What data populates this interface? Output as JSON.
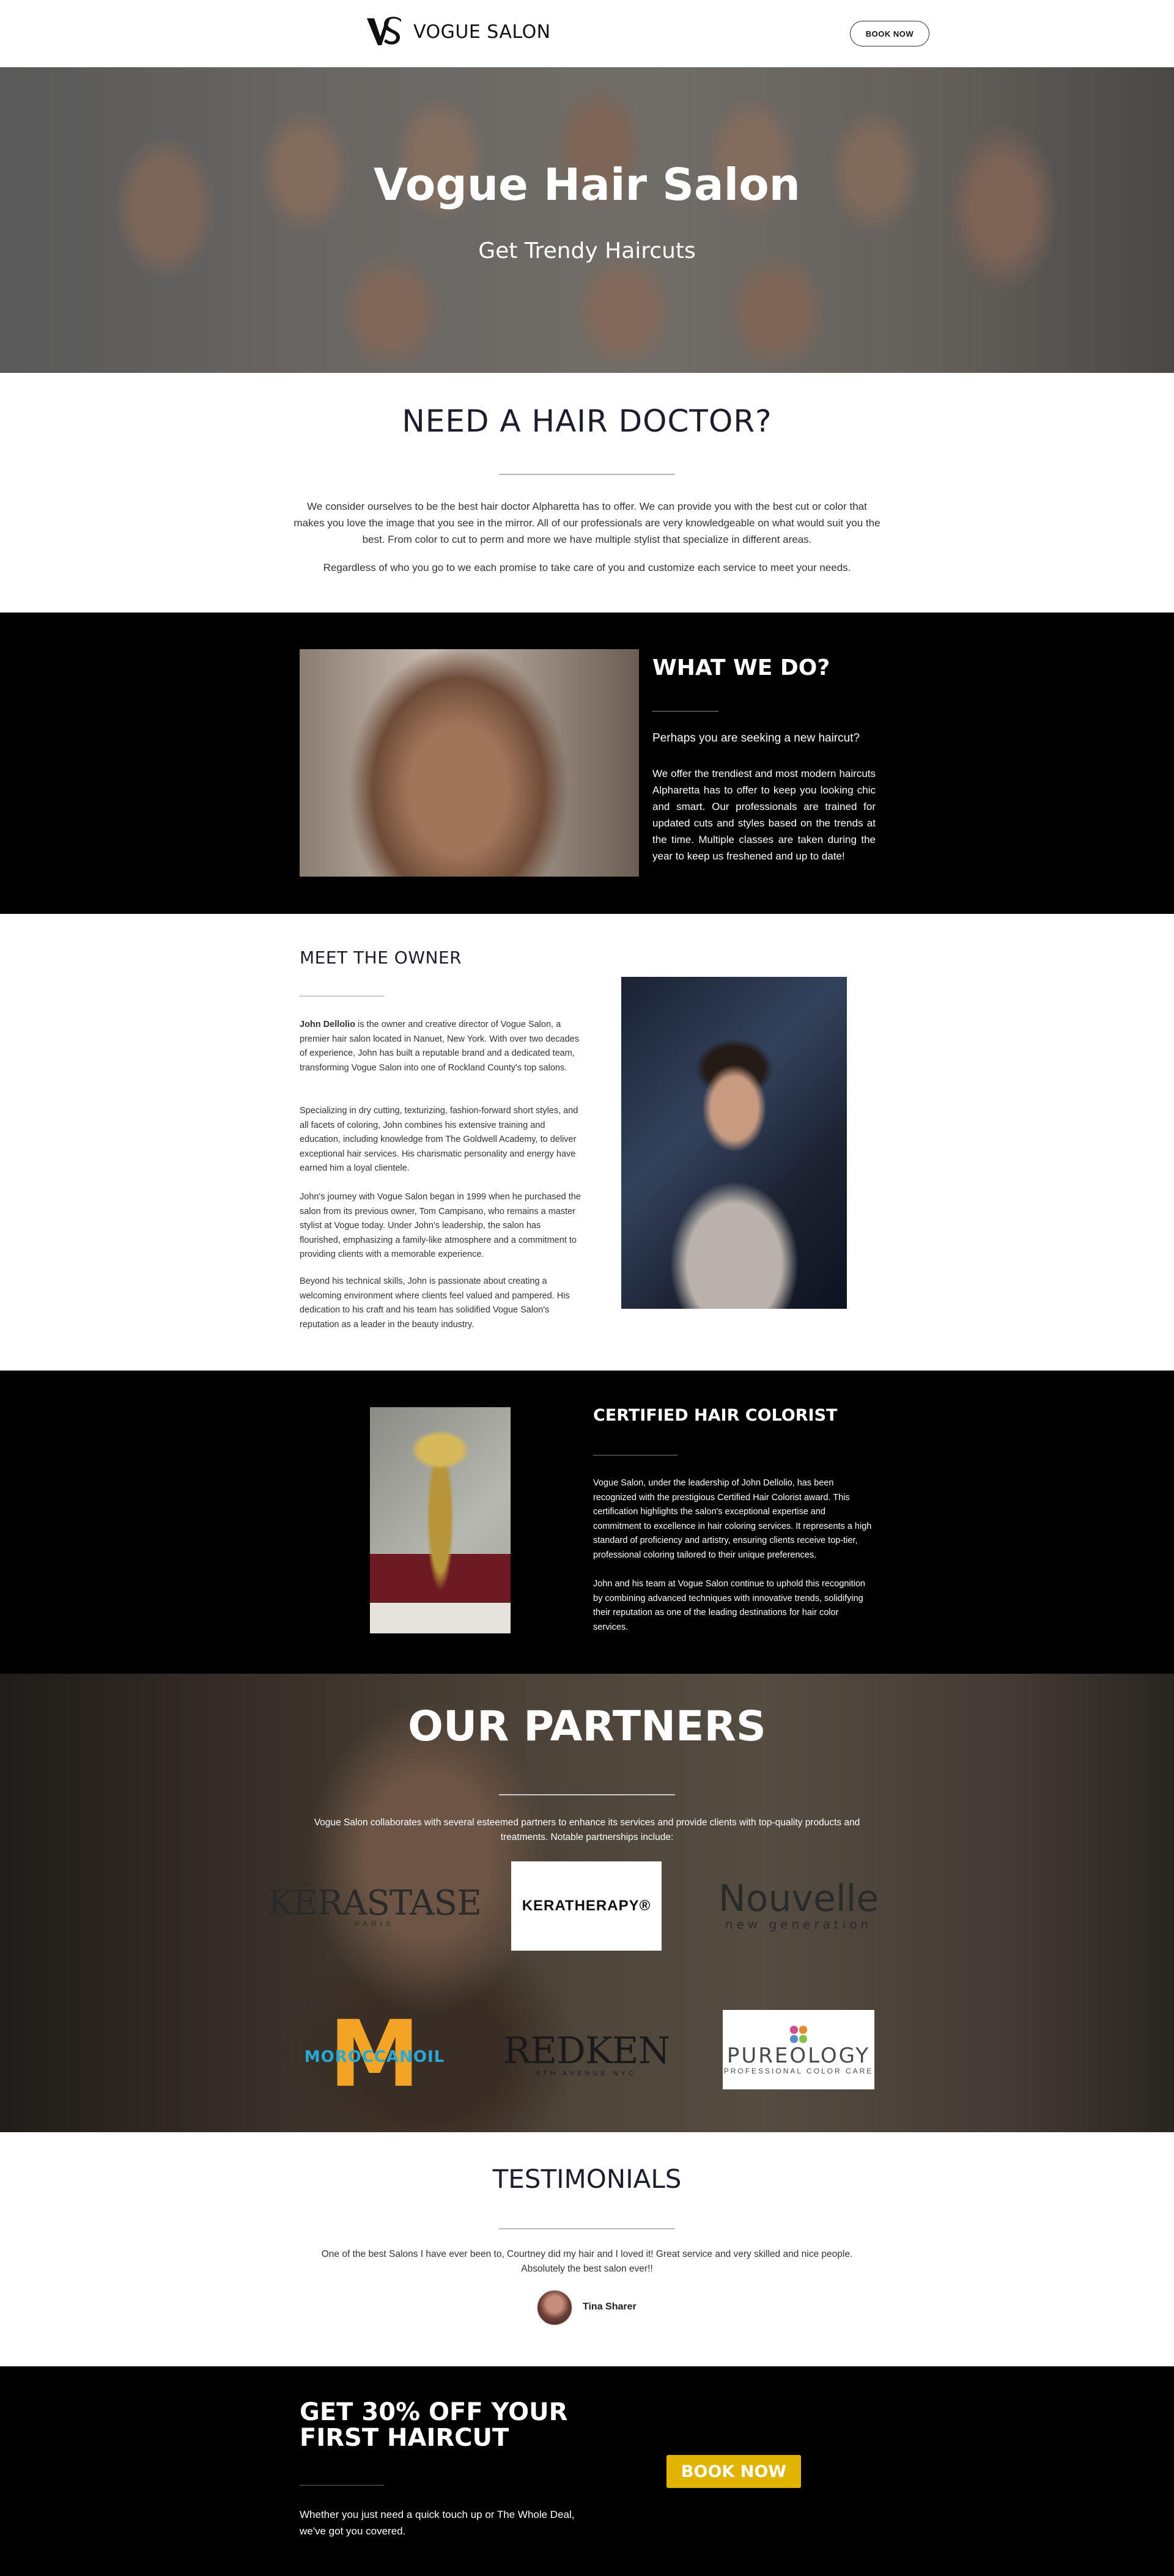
{
  "header": {
    "brand": "VOGUE SALON",
    "logo_icon": "vs-monogram-icon",
    "book_now": "BOOK NOW"
  },
  "hero": {
    "title": "Vogue Hair Salon",
    "subtitle": "Get Trendy Haircuts"
  },
  "doctor": {
    "title": "NEED A HAIR DOCTOR?",
    "p1": "We consider ourselves to be the best hair doctor Alpharetta has to offer. We can provide you with the best cut or color that makes you love the image that you see in the mirror. All of our professionals are very knowledgeable on what would suit you the best. From color to cut to perm and more we have multiple stylist that specialize in different areas.",
    "p2": "Regardless of who you go to we each promise to take care of you and customize each service to meet your needs."
  },
  "what": {
    "title": "WHAT WE DO?",
    "question": "Perhaps you are seeking a new haircut?",
    "body": "We offer the trendiest and most modern haircuts Alpharetta has to offer to keep you looking chic and smart. Our professionals are trained for updated cuts and styles based on the trends at the time. Multiple classes are taken during the year to keep us freshened and up to date!"
  },
  "owner": {
    "title": "MEET THE OWNER",
    "name": "John Dellolio",
    "p1": " is the owner and creative director of Vogue Salon, a premier hair salon located in Nanuet, New York. With over two decades of experience, John has built a reputable brand and a dedicated team, transforming Vogue Salon into one of Rockland County's top salons.",
    "p2": "Specializing in dry cutting, texturizing, fashion-forward short styles, and all facets of coloring, John combines his extensive training and education, including knowledge from The Goldwell Academy, to deliver exceptional hair services. His charismatic personality and energy have earned him a loyal clientele.",
    "p3": "John's journey with Vogue Salon began in 1999 when he purchased the salon from its previous owner, Tom Campisano, who remains a master stylist at Vogue today. Under John's leadership, the salon has flourished, emphasizing a family-like atmosphere and a commitment to providing clients with a memorable experience.",
    "p4": "Beyond his technical skills, John is passionate about creating a welcoming environment where clients feel valued and pampered. His dedication to his craft and his team has solidified Vogue Salon's reputation as a leader in the beauty industry."
  },
  "certified": {
    "title": "CERTIFIED HAIR COLORIST",
    "p1": "Vogue Salon, under the leadership of John Dellolio, has been recognized with the prestigious Certified Hair Colorist award. This certification highlights the salon's exceptional expertise and commitment to excellence in hair coloring services. It represents a high standard of proficiency and artistry, ensuring clients receive top-tier, professional coloring tailored to their unique preferences.",
    "p2": "John and his team at Vogue Salon continue to uphold this recognition by combining advanced techniques with innovative trends, solidifying their reputation as one of the leading destinations for hair color services."
  },
  "partners": {
    "title": "OUR PARTNERS",
    "body": "Vogue Salon collaborates with several esteemed partners to enhance its services and provide clients with top-quality products and treatments. Notable partnerships include:",
    "logos": [
      {
        "name": "KÉRASTASE",
        "sub": "PARIS"
      },
      {
        "name": "KERATHERAPY®",
        "sub": ""
      },
      {
        "name": "Nouvelle",
        "sub": "new generation"
      },
      {
        "name": "MOROCCANOIL",
        "sub": ""
      },
      {
        "name": "REDKEN",
        "sub": "5TH AVENUE NYC"
      },
      {
        "name": "PUREOLOGY",
        "sub": "PROFESSIONAL COLOR CARE"
      }
    ]
  },
  "testimonials": {
    "title": "TESTIMONIALS",
    "quote": "One of the best Salons I have ever been to, Courtney did my hair and I loved it! Great service and very skilled and nice people. Absolutely the best salon ever!!",
    "author": "Tina Sharer"
  },
  "offer": {
    "title": "GET 30% OFF YOUR FIRST HAIRCUT",
    "body": "Whether you just need a quick touch up or The Whole Deal, we've got you covered.",
    "button": "BOOK NOW",
    "button_color": "#e0b400"
  }
}
